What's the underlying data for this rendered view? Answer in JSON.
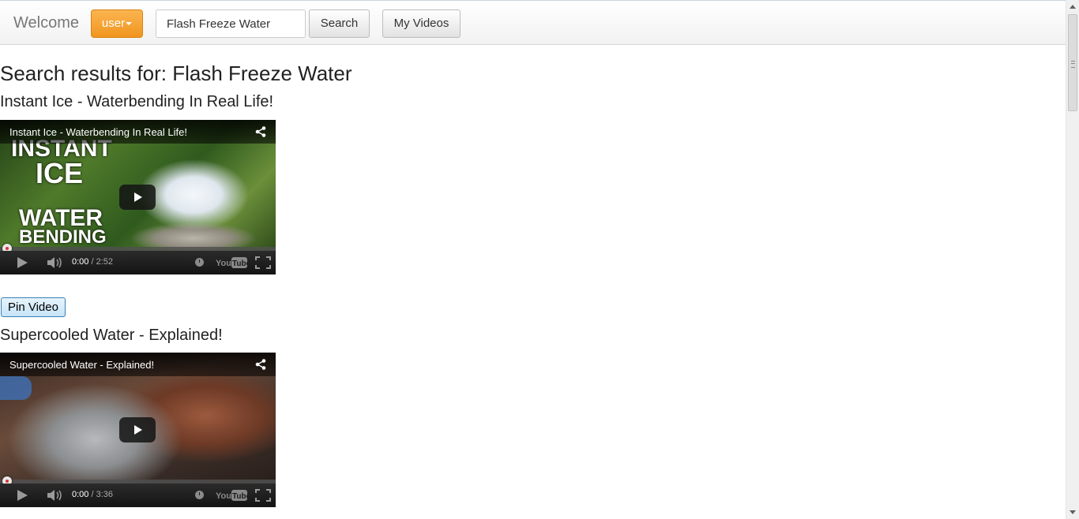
{
  "navbar": {
    "brand": "Welcome",
    "user_label": "user",
    "search_value": "Flash Freeze Water",
    "search_button": "Search",
    "my_videos_button": "My Videos"
  },
  "results": {
    "heading": "Search results for: Flash Freeze Water",
    "videos": [
      {
        "title": "Instant Ice - Waterbending In Real Life!",
        "player_title": "Instant Ice - Waterbending In Real Life!",
        "thumb_lines": [
          "INSTANT",
          "ICE",
          "WATER",
          "BENDING"
        ],
        "current_time": "0:00",
        "duration": "2:52",
        "pin_label": "Pin Video"
      },
      {
        "title": "Supercooled Water - Explained!",
        "player_title": "Supercooled Water - Explained!",
        "current_time": "0:00",
        "duration": "3:36"
      }
    ]
  },
  "icons": {
    "share": "share-icon",
    "volume": "volume-icon",
    "clock": "watch-later-icon",
    "youtube": "youtube-logo-icon",
    "fullscreen": "fullscreen-icon"
  },
  "colors": {
    "user_button": "#f0961f",
    "pin_button_border": "#3c7fb1"
  }
}
